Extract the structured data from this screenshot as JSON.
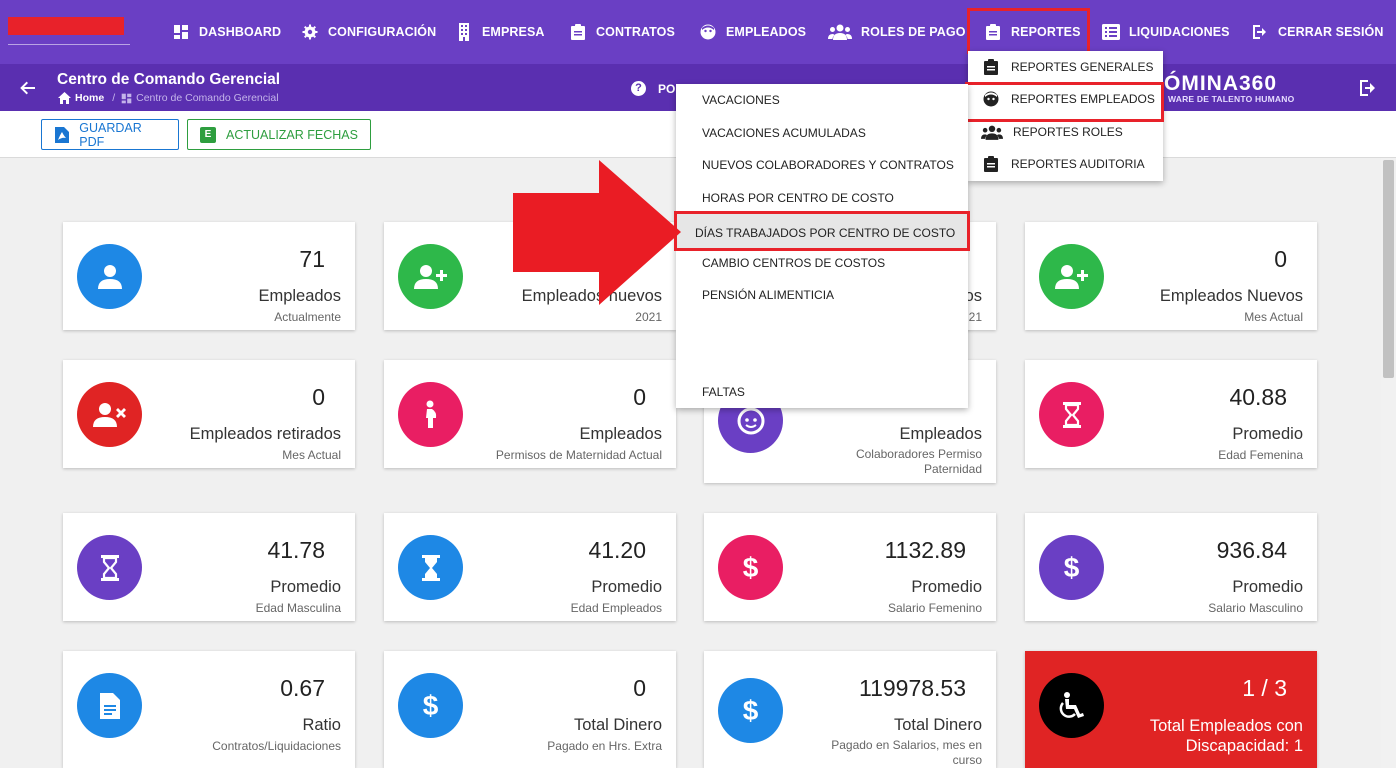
{
  "nav": {
    "items": [
      {
        "label": "DASHBOARD",
        "icon": "dashboard-icon"
      },
      {
        "label": "CONFIGURACIÓN",
        "icon": "gear-icon"
      },
      {
        "label": "EMPRESA",
        "icon": "building-icon"
      },
      {
        "label": "CONTRATOS",
        "icon": "clipboard-icon"
      },
      {
        "label": "EMPLEADOS",
        "icon": "face-icon"
      },
      {
        "label": "ROLES DE PAGO",
        "icon": "people-icon"
      },
      {
        "label": "REPORTES",
        "icon": "clipboard-icon"
      },
      {
        "label": "LIQUIDACIONES",
        "icon": "list-icon"
      },
      {
        "label": "CERRAR SESIÓN",
        "icon": "logout-icon"
      }
    ]
  },
  "header": {
    "title": "Centro de Comando Gerencial",
    "breadcrumb_home": "Home",
    "breadcrumb_current": "Centro de Comando Gerencial",
    "help_text": "PO",
    "brand": "ÓMINA360",
    "brand_sub": "WARE DE TALENTO HUMANO"
  },
  "toolbar": {
    "pdf_label": "GUARDAR PDF",
    "update_label": "ACTUALIZAR FECHAS",
    "excel_glyph": "E"
  },
  "reportes_menu": {
    "items": [
      {
        "label": "REPORTES GENERALES",
        "icon": "clipboard-icon"
      },
      {
        "label": "REPORTES EMPLEADOS",
        "icon": "face-icon"
      },
      {
        "label": "REPORTES ROLES",
        "icon": "people-icon"
      },
      {
        "label": "REPORTES AUDITORIA",
        "icon": "clipboard-icon"
      }
    ]
  },
  "empleados_menu": {
    "items": [
      "VACACIONES",
      "VACACIONES ACUMULADAS",
      "NUEVOS COLABORADORES Y CONTRATOS",
      "HORAS POR CENTRO DE COSTO",
      "DÍAS TRABAJADOS POR CENTRO DE COSTO",
      "CAMBIO CENTROS DE COSTOS",
      "PENSIÓN ALIMENTICIA",
      "FALTAS"
    ]
  },
  "cards": [
    {
      "value": "71",
      "label": "Empleados",
      "sub": "Actualmente",
      "color": "#1e88e5",
      "icon": "person-icon"
    },
    {
      "value": "",
      "label": "Empleados nuevos",
      "sub": "2021",
      "color": "#2eb84a",
      "icon": "person-add-icon"
    },
    {
      "value": "",
      "label": "os",
      "sub": "21",
      "color": "#6a3fc4",
      "icon": "person-icon"
    },
    {
      "value": "0",
      "label": "Empleados Nuevos",
      "sub": "Mes Actual",
      "color": "#2eb84a",
      "icon": "person-add-icon"
    },
    {
      "value": "0",
      "label": "Empleados retirados",
      "sub": "Mes Actual",
      "color": "#e02424",
      "icon": "person-remove-icon"
    },
    {
      "value": "0",
      "label": "Empleados",
      "sub": "Permisos de Maternidad Actual",
      "color": "#e91e63",
      "icon": "pregnant-icon"
    },
    {
      "value": "",
      "label": "Empleados",
      "sub": "Colaboradores Permiso Paternidad",
      "color": "#6a3fc4",
      "icon": "baby-face-icon"
    },
    {
      "value": "40.88",
      "label": "Promedio",
      "sub": "Edad Femenina",
      "color": "#e91e63",
      "icon": "hourglass-icon"
    },
    {
      "value": "41.78",
      "label": "Promedio",
      "sub": "Edad Masculina",
      "color": "#6a3fc4",
      "icon": "hourglass-icon"
    },
    {
      "value": "41.20",
      "label": "Promedio",
      "sub": "Edad Empleados",
      "color": "#1e88e5",
      "icon": "hourglass-icon"
    },
    {
      "value": "1132.89",
      "label": "Promedio",
      "sub": "Salario Femenino",
      "color": "#e91e63",
      "icon": "dollar-icon"
    },
    {
      "value": "936.84",
      "label": "Promedio",
      "sub": "Salario Masculino",
      "color": "#6a3fc4",
      "icon": "dollar-icon"
    },
    {
      "value": "0.67",
      "label": "Ratio",
      "sub": "Contratos/Liquidaciones",
      "color": "#1e88e5",
      "icon": "document-icon"
    },
    {
      "value": "0",
      "label": "Total Dinero",
      "sub": "Pagado en Hrs. Extra",
      "color": "#1e88e5",
      "icon": "dollar-icon"
    },
    {
      "value": "119978.53",
      "label": "Total Dinero",
      "sub": "Pagado en Salarios, mes en curso",
      "color": "#1e88e5",
      "icon": "dollar-icon"
    },
    {
      "value": "1 / 3",
      "label": "Total Empleados con Discapacidad: 1",
      "sub": "",
      "color": "#000000",
      "icon": "wheelchair-icon"
    }
  ]
}
